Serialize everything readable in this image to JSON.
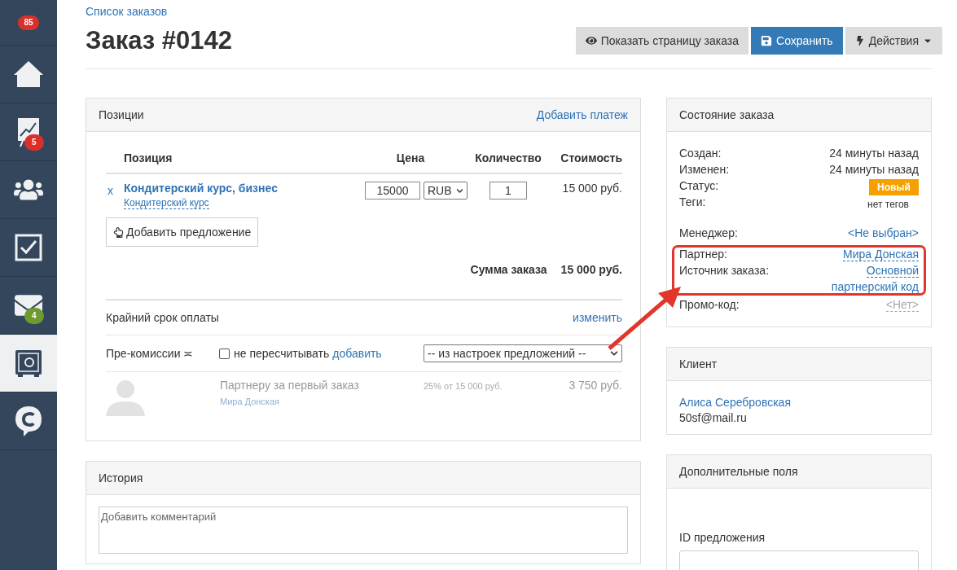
{
  "sidebar": {
    "top_badge": {
      "text": "85",
      "color": "#d9302c"
    },
    "items": [
      {
        "kind": "home",
        "selected": false
      },
      {
        "kind": "chart",
        "selected": false,
        "badge": {
          "text": "5",
          "color": "#d9302c"
        }
      },
      {
        "kind": "people",
        "selected": false
      },
      {
        "kind": "tasks",
        "selected": false
      },
      {
        "kind": "mail",
        "selected": false,
        "badge": {
          "text": "4",
          "color": "#6e9a2e"
        }
      },
      {
        "kind": "safe",
        "selected": true
      },
      {
        "kind": "chat",
        "selected": false
      }
    ]
  },
  "breadcrumb": "Список заказов",
  "title": "Заказ #0142",
  "actions": [
    {
      "kind": "view",
      "label": "Показать страницу заказа"
    },
    {
      "kind": "save",
      "label": "Сохранить"
    },
    {
      "kind": "menu",
      "label": "Действия"
    }
  ],
  "positions": {
    "title": "Позиции",
    "link": "Добавить платеж",
    "columns": [
      "Позиция",
      "Цена",
      "Количество",
      "Стоимость"
    ],
    "rows": [
      {
        "remove": "x",
        "name": "Кондитерский курс, бизнес",
        "subtitle": "Кондитерский курс",
        "price": "15000",
        "currency": "RUB",
        "quantity": "1",
        "cost": "15 000 руб."
      }
    ],
    "add_button": "Добавить предложение",
    "total_label": "Сумма заказа",
    "total": "15 000 руб.",
    "deadline_label": "Крайний срок оплаты",
    "deadline_link": "изменить",
    "commission_label": "Пре-комиссии ≍",
    "recalc": {
      "label": "не пересчитывать",
      "checked": false
    },
    "add_link": "добавить",
    "commission_select": "-- из настроек предложений --",
    "commissions": [
      {
        "title": "Партнеру за первый заказ",
        "partner": "Мира Донская",
        "formula": "25% от 15 000 руб.",
        "amount": "3 750 руб."
      }
    ]
  },
  "history": {
    "title": "История",
    "comment": {
      "placeholder": "Добавить комментарий"
    }
  },
  "status_card": {
    "title": "Состояние заказа",
    "rows": [
      {
        "kind": "text",
        "label": "Создан:",
        "value": "24 минуты назад"
      },
      {
        "kind": "text",
        "label": "Изменен:",
        "value": "24 минуты назад"
      },
      {
        "kind": "badge",
        "label": "Статус:",
        "value": "Новый",
        "color": "#f5a000"
      },
      {
        "kind": "muted",
        "label": "Теги:",
        "value": "нет тегов"
      }
    ],
    "assignment": [
      {
        "highlight": false,
        "rows": [
          {
            "kind": "link",
            "label": "Менеджер:",
            "value": "<Не выбран>"
          }
        ]
      },
      {
        "highlight": true,
        "rows": [
          {
            "kind": "dashed",
            "label": "Партнер:",
            "value": "Мира Донская"
          },
          {
            "kind": "dashed",
            "label": "Источник заказа:",
            "value": "Основной",
            "extra": "партнерский код"
          }
        ]
      },
      {
        "highlight": false,
        "rows": [
          {
            "kind": "grey",
            "label": "Промо-код:",
            "value": "<Нет>"
          }
        ]
      }
    ]
  },
  "client_card": {
    "title": "Клиент",
    "name": "Алиса Серебровская",
    "email": "50sf@mail.ru"
  },
  "extra_card": {
    "title": "Дополнительные поля",
    "fields": [
      {
        "label": "ID предложения"
      }
    ]
  }
}
